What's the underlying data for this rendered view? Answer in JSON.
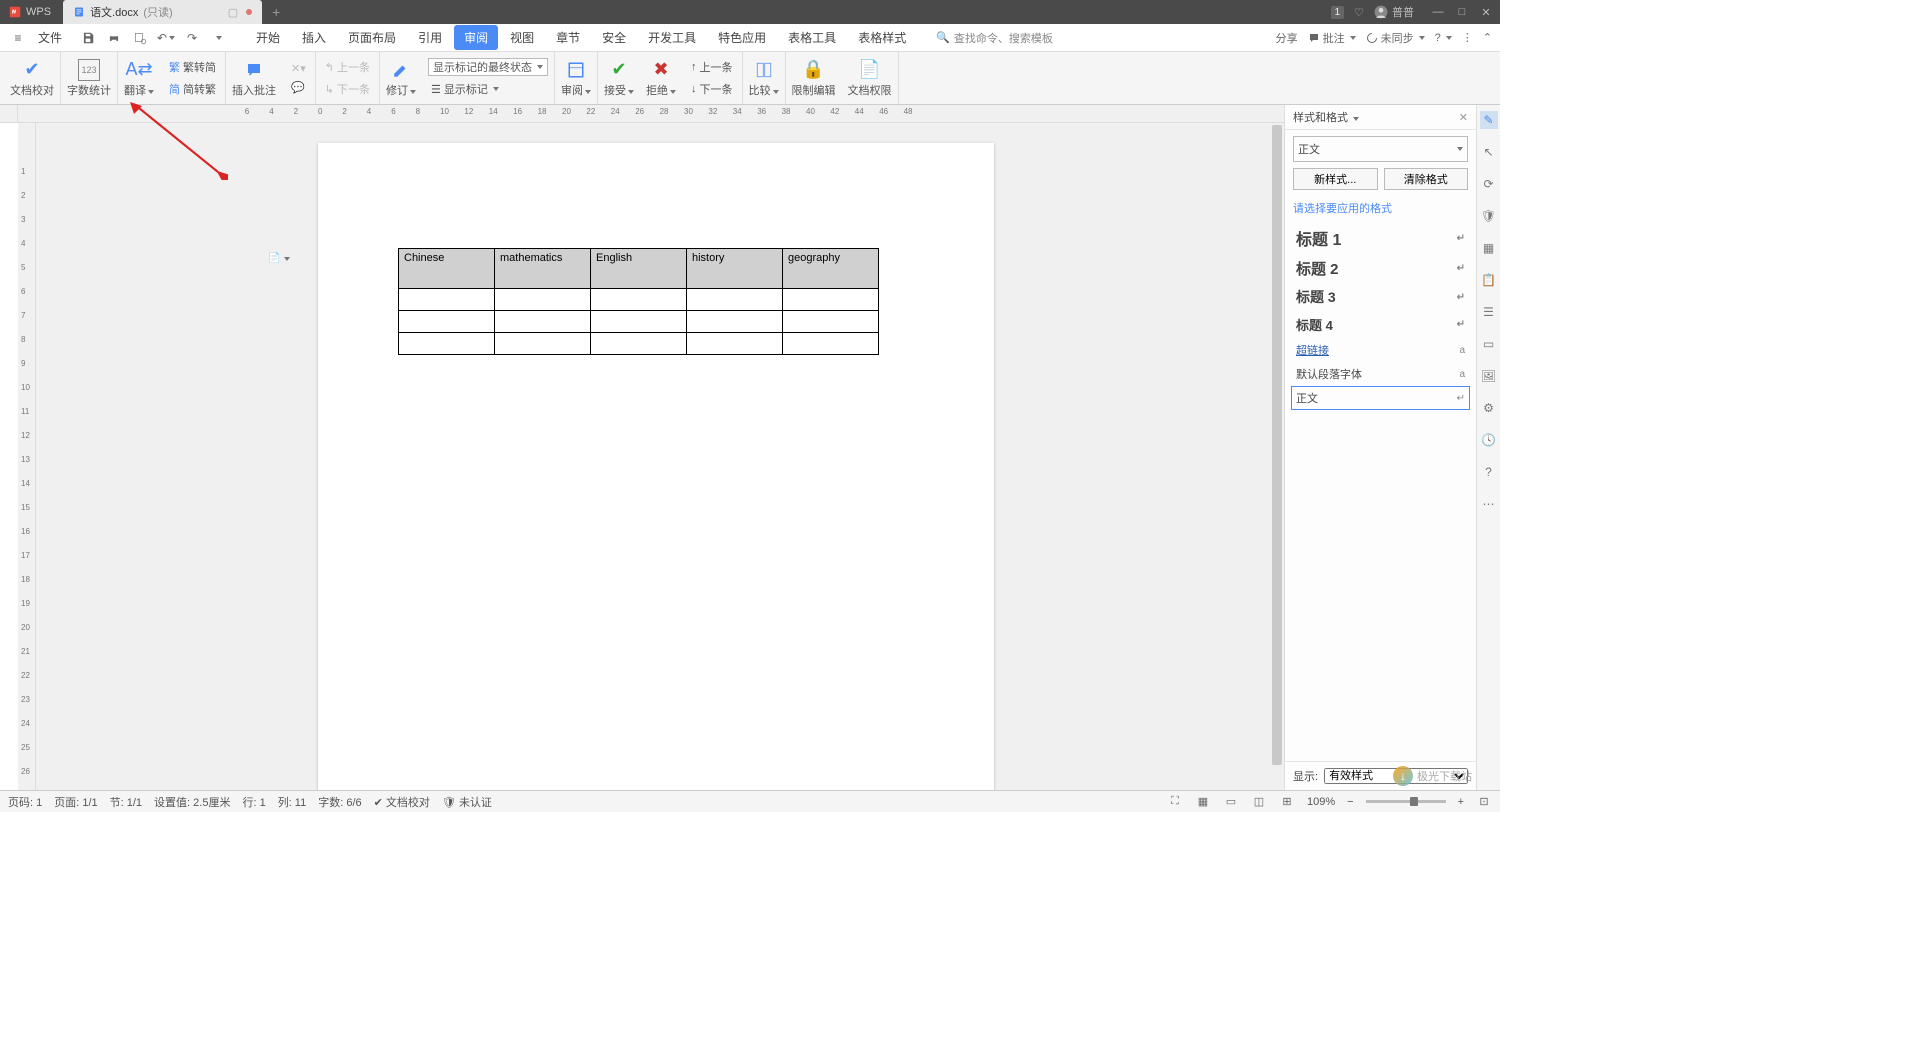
{
  "titlebar": {
    "app": "WPS",
    "tab_name": "语文.docx",
    "tab_suffix": "(只读)",
    "badge": "1",
    "user": "普普"
  },
  "menubar": {
    "file": "文件",
    "tabs": [
      "开始",
      "插入",
      "页面布局",
      "引用",
      "审阅",
      "视图",
      "章节",
      "安全",
      "开发工具",
      "特色应用",
      "表格工具",
      "表格样式"
    ],
    "active_tab_index": 4,
    "search_placeholder": "查找命令、搜索模板",
    "right": {
      "share": "分享",
      "annotate": "批注",
      "sync": "未同步"
    }
  },
  "ribbon": {
    "proof": "文档校对",
    "wordcount": "字数统计",
    "translate": "翻译",
    "fanjian": "繁转简",
    "jianfan": "简转繁",
    "insert_comment": "插入批注",
    "revise": "修订",
    "markup_dropdown": "显示标记的最终状态",
    "show_markup": "显示标记",
    "review_pane": "审阅",
    "accept": "接受",
    "reject": "拒绝",
    "prev": "上一条",
    "next": "下一条",
    "compare": "比较",
    "restrict": "限制编辑",
    "doc_perm": "文档权限"
  },
  "document": {
    "table": {
      "headers": [
        "Chinese",
        "mathematics",
        "English",
        "history",
        "geography"
      ],
      "rows": 3
    }
  },
  "styles_panel": {
    "title": "样式和格式",
    "current": "正文",
    "new_btn": "新样式...",
    "clear_btn": "清除格式",
    "hint": "请选择要应用的格式",
    "items": [
      {
        "label": "标题 1",
        "cls": "h1"
      },
      {
        "label": "标题 2",
        "cls": "h2"
      },
      {
        "label": "标题 3",
        "cls": "h3"
      },
      {
        "label": "标题 4",
        "cls": "h4"
      },
      {
        "label": "超链接",
        "cls": "link"
      },
      {
        "label": "默认段落字体",
        "cls": ""
      },
      {
        "label": "正文",
        "cls": "selected"
      }
    ],
    "footer_label": "显示:",
    "footer_value": "有效样式"
  },
  "statusbar": {
    "page_label": "页码: 1",
    "page_of": "页面: 1/1",
    "section": "节: 1/1",
    "position": "设置值: 2.5厘米",
    "line": "行: 1",
    "col": "列: 11",
    "chars": "字数: 6/6",
    "proof": "文档校对",
    "verify": "未认证",
    "zoom": "109%"
  },
  "watermark": "极光下载站"
}
